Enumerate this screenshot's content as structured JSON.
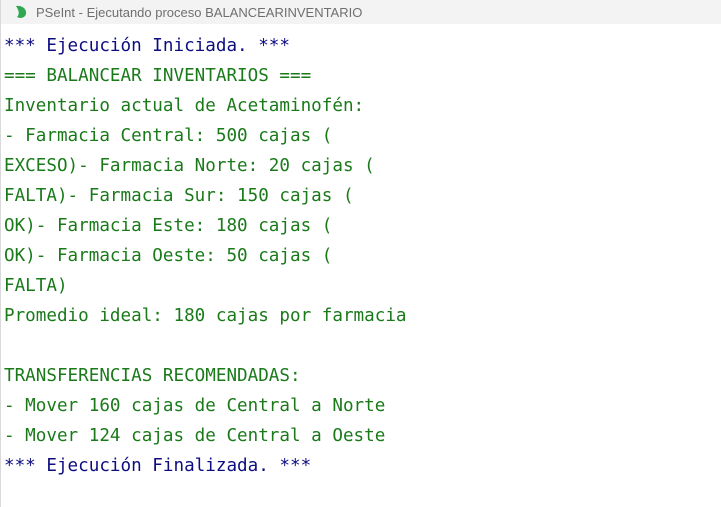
{
  "window": {
    "title": "PSeInt - Ejecutando proceso BALANCEARINVENTARIO",
    "icon": "pseint-logo-icon"
  },
  "colors": {
    "system_text": "#0d0d80",
    "output_text": "#1a7a1a",
    "logo": "#2fa84f"
  },
  "console": {
    "lines": [
      {
        "text": "*** Ejecución Iniciada. ***",
        "kind": "sys"
      },
      {
        "text": "=== BALANCEAR INVENTARIOS ===",
        "kind": "out"
      },
      {
        "text": "Inventario actual de Acetaminofén:",
        "kind": "out"
      },
      {
        "text": "- Farmacia Central: 500 cajas (",
        "kind": "out"
      },
      {
        "text": "EXCESO)- Farmacia Norte: 20 cajas (",
        "kind": "out"
      },
      {
        "text": "FALTA)- Farmacia Sur: 150 cajas (",
        "kind": "out"
      },
      {
        "text": "OK)- Farmacia Este: 180 cajas (",
        "kind": "out"
      },
      {
        "text": "OK)- Farmacia Oeste: 50 cajas (",
        "kind": "out"
      },
      {
        "text": "FALTA)",
        "kind": "out"
      },
      {
        "text": "Promedio ideal: 180 cajas por farmacia",
        "kind": "out"
      },
      {
        "text": "",
        "kind": "out"
      },
      {
        "text": "TRANSFERENCIAS RECOMENDADAS:",
        "kind": "out"
      },
      {
        "text": "- Mover 160 cajas de Central a Norte",
        "kind": "out"
      },
      {
        "text": "- Mover 124 cajas de Central a Oeste",
        "kind": "out"
      },
      {
        "text": "*** Ejecución Finalizada. ***",
        "kind": "sys"
      }
    ]
  }
}
